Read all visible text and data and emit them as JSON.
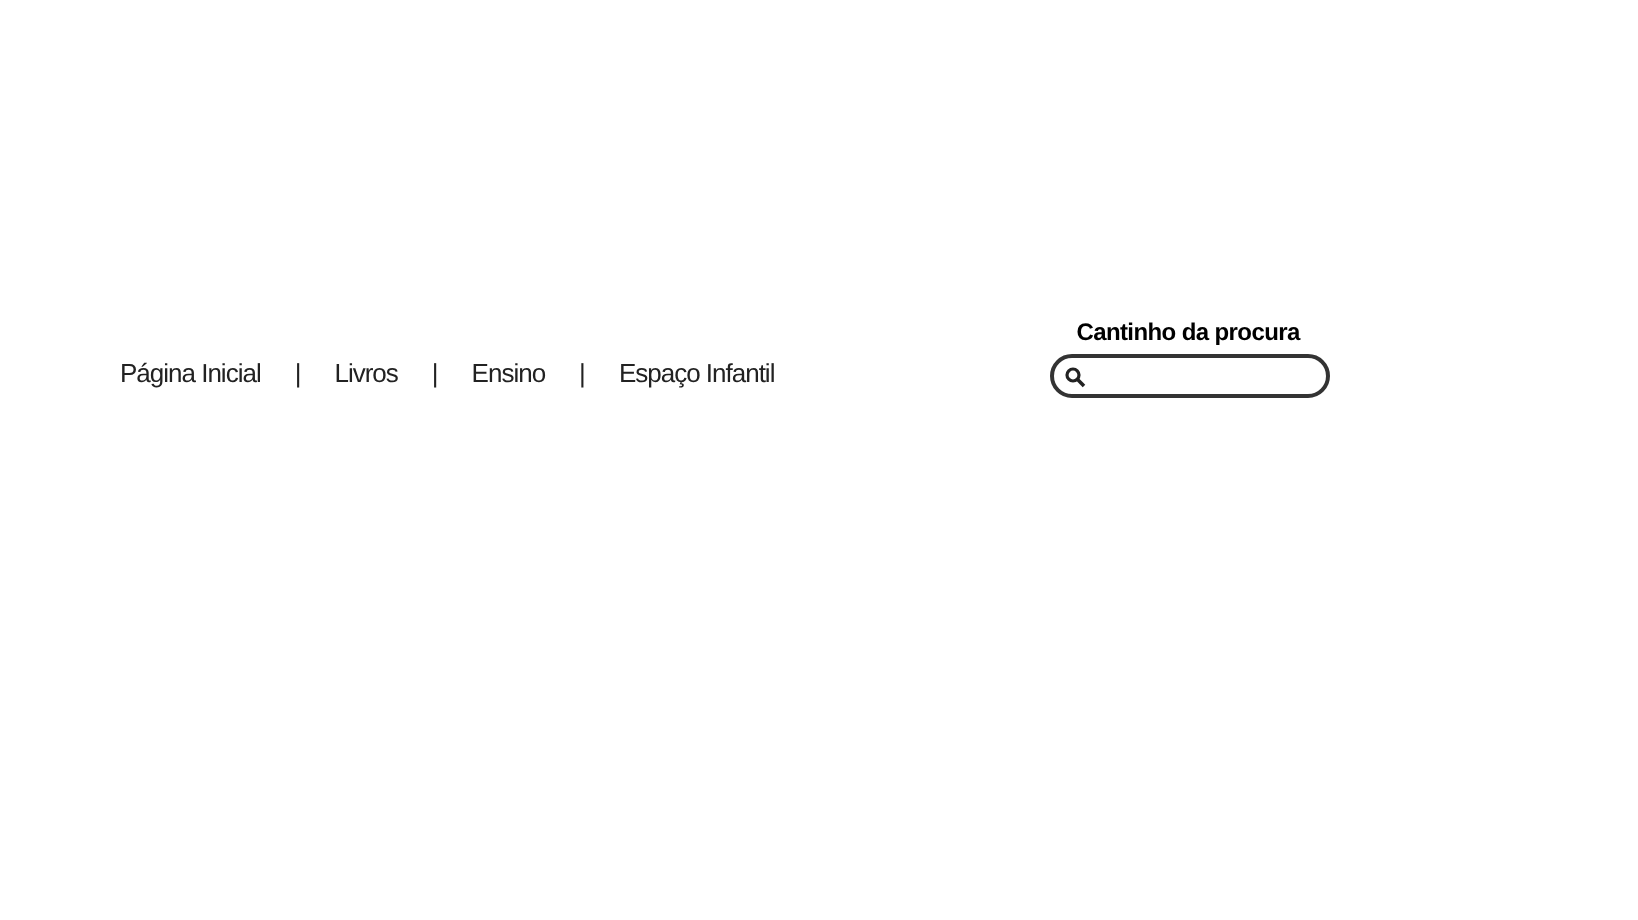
{
  "nav": [
    {
      "label": "Página Inicial",
      "separator": "|"
    },
    {
      "label": "Livros",
      "separator": "|"
    },
    {
      "label": "Ensino",
      "separator": "|"
    },
    {
      "label": "Espaço Infantil"
    }
  ],
  "search": {
    "label": "Cantinho da procura"
  }
}
